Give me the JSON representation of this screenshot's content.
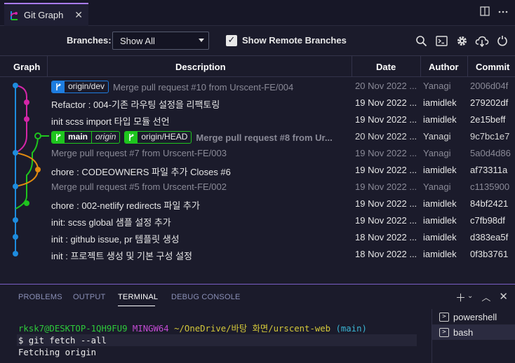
{
  "tab": {
    "title": "Git Graph",
    "close": "✕"
  },
  "controls": {
    "branches_label": "Branches:",
    "branches_value": "Show All",
    "show_remote_label": "Show Remote Branches",
    "show_remote_checked": true
  },
  "table": {
    "headers": [
      "Graph",
      "Description",
      "Date",
      "Author",
      "Commit"
    ],
    "rows": [
      {
        "style": "muted",
        "refs": [
          {
            "kind": "remote",
            "name": "origin/dev"
          }
        ],
        "message": "Merge pull request #10 from Urscent-FE/004",
        "date": "20 Nov 2022 ...",
        "author": "Yanagi",
        "commit": "2006d04f"
      },
      {
        "style": "normal",
        "refs": [],
        "message": "Refactor : 004-기존 라우팅 설정을 리팩토링",
        "date": "19 Nov 2022 ...",
        "author": "iamidlek",
        "commit": "279202df"
      },
      {
        "style": "normal",
        "refs": [],
        "message": "init scss import 타입 모듈 선언",
        "date": "19 Nov 2022 ...",
        "author": "iamidlek",
        "commit": "2e15beff"
      },
      {
        "style": "head",
        "refs": [
          {
            "kind": "local",
            "name": "main",
            "sub": "origin"
          },
          {
            "kind": "head",
            "name": "origin/HEAD"
          }
        ],
        "message": "Merge pull request #8 from Ur...",
        "date": "20 Nov 2022 ...",
        "author": "Yanagi",
        "commit": "9c7bc1e7"
      },
      {
        "style": "muted",
        "refs": [],
        "message": "Merge pull request #7 from Urscent-FE/003",
        "date": "19 Nov 2022 ...",
        "author": "Yanagi",
        "commit": "5a0d4d86"
      },
      {
        "style": "normal",
        "refs": [],
        "message": "chore : CODEOWNERS 파일 추가 Closes #6",
        "date": "19 Nov 2022 ...",
        "author": "iamidlek",
        "commit": "af73311a"
      },
      {
        "style": "muted",
        "refs": [],
        "message": "Merge pull request #5 from Urscent-FE/002",
        "date": "19 Nov 2022 ...",
        "author": "Yanagi",
        "commit": "c1135900"
      },
      {
        "style": "normal",
        "refs": [],
        "message": "chore : 002-netlify redirects 파일 추가",
        "date": "19 Nov 2022 ...",
        "author": "iamidlek",
        "commit": "84bf2421"
      },
      {
        "style": "normal",
        "refs": [],
        "message": "init: scss global 샘플 설정 추가",
        "date": "19 Nov 2022 ...",
        "author": "iamidlek",
        "commit": "c7fb98df"
      },
      {
        "style": "normal",
        "refs": [],
        "message": "init : github issue, pr 템플릿 생성",
        "date": "18 Nov 2022 ...",
        "author": "iamidlek",
        "commit": "d383ea5f"
      },
      {
        "style": "normal",
        "refs": [],
        "message": "init : 프로젝트 생성 및 기본 구성 설정",
        "date": "18 Nov 2022 ...",
        "author": "iamidlek",
        "commit": "0f3b3761"
      }
    ]
  },
  "graph_colors": {
    "blue": "#1e8cde",
    "magenta": "#d426a8",
    "green": "#1ec51e",
    "orange": "#e08a10"
  },
  "panel": {
    "tabs": [
      "PROBLEMS",
      "OUTPUT",
      "TERMINAL",
      "DEBUG CONSOLE"
    ],
    "active_tab": "TERMINAL",
    "terminal": {
      "user_host": "rksk7@DESKTOP-1QH9FU9",
      "shell": "MINGW64",
      "path": "~/OneDrive/바탕 화면/urscent-web",
      "branch": "(main)",
      "command": "$ git fetch --all",
      "output": "Fetching origin"
    },
    "shells": [
      "powershell",
      "bash"
    ],
    "active_shell": "bash"
  }
}
